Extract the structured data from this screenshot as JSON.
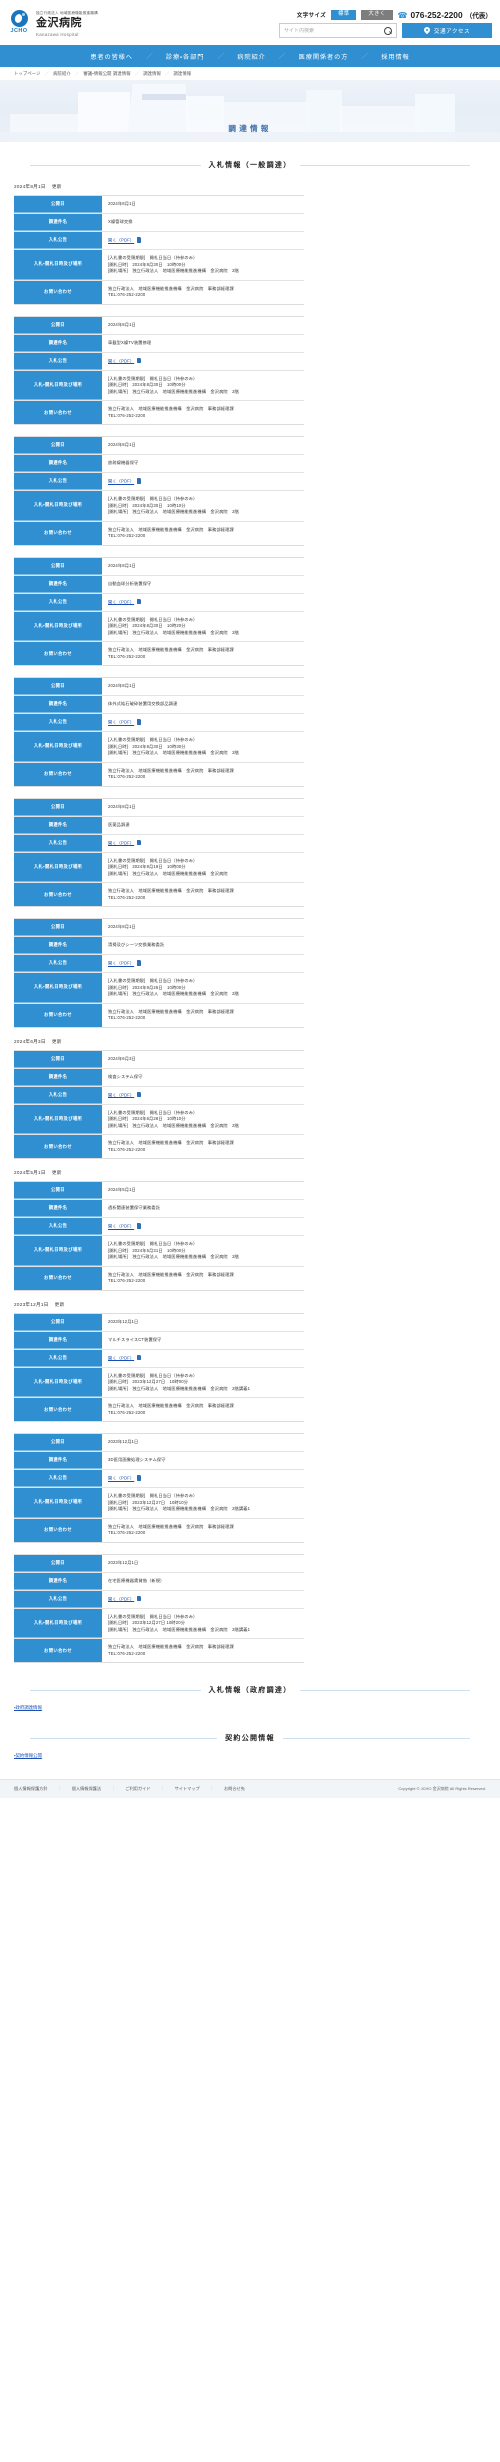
{
  "header": {
    "org_line": "独立行政法人 地域医療機能推進機構",
    "name_jp": "金沢病院",
    "name_en": "Kanazawa Hospital",
    "logo_text": "JCHO",
    "fontsize_label": "文字サイズ",
    "fontsize_standard": "標準",
    "fontsize_large": "大きく",
    "tel_icon": "phone-icon",
    "tel": "076-252-2200",
    "tel_suffix": "（代表）",
    "search_placeholder": "サイト内検索",
    "search_value": "",
    "search_icon": "search-icon",
    "access_label": "交通アクセス",
    "access_icon": "map-pin-icon"
  },
  "nav": {
    "items": [
      "患者の皆様へ",
      "診療・各部門",
      "病院紹介",
      "医療関係者の方",
      "採用情報"
    ],
    "separator": "／"
  },
  "breadcrumb": {
    "items": [
      "トップページ",
      "病院紹介",
      "審議・情報公開 調達情報",
      "調達情報",
      "調達情報"
    ],
    "separator": "／"
  },
  "hero": {
    "title": "調達情報"
  },
  "sections": {
    "ippan_title": "入札情報（一般調達）",
    "seifu_title": "入札情報（政府調達）",
    "keiyaku_title": "契約公開情報",
    "seifu_link": "・政府調達情報",
    "keiyaku_link": "・契約情報公開"
  },
  "labels": {
    "koukaibi": "公開日",
    "choutatsu": "調達件名",
    "koukoku": "入札公告",
    "nyuusatsu": "入札・開札日時及び場所",
    "toiawase": "お問い合わせ",
    "pdf_link": "開く（PDF）",
    "pdf_icon": "pdf-file-icon",
    "update_suffix": "更新",
    "contact_org": "独立行政法人　地域医療機能推進機構　金沢病院　事務部経理課",
    "contact_tel": "TEL:076-252-2200",
    "bid_deadline_label": "[入札書の受領期限]",
    "bid_deadline_value": "開札日当日（持参のみ）",
    "bid_datetime_label": "[開札日時]",
    "bid_place_label": "[開札場所]",
    "bid_place_value": "独立行政法人　地域医療機能推進機構　金沢病院　2階"
  },
  "groups": [
    {
      "date_head": "2024年8月1日",
      "cards": [
        {
          "koukaibi": "2024年8月1日",
          "choutatsu": "X線管球交換",
          "bid_datetime": "2024年8月30日　10時00分",
          "bid_place": "独立行政法人　地域医療機能推進機構　金沢病院　2階"
        },
        {
          "koukaibi": "2024年8月1日",
          "choutatsu": "車載型X線TV装置修理",
          "bid_datetime": "2024年8月30日　10時00分",
          "bid_place": "独立行政法人　地域医療機能推進機構　金沢病院　2階"
        },
        {
          "koukaibi": "2024年8月1日",
          "choutatsu": "放射線機器保守",
          "bid_datetime": "2024年8月30日　10時10分",
          "bid_place": "独立行政法人　地域医療機能推進機構　金沢病院　2階"
        },
        {
          "koukaibi": "2024年8月1日",
          "choutatsu": "自動血球分析装置保守",
          "bid_datetime": "2024年8月30日　10時20分",
          "bid_place": "独立行政法人　地域医療機能推進機構　金沢病院　2階"
        },
        {
          "koukaibi": "2024年8月1日",
          "choutatsu": "体外式結石破砕装置用交換部品調達",
          "bid_datetime": "2024年8月30日　10時30分",
          "bid_place": "独立行政法人　地域医療機能推進機構　金沢病院　2階"
        },
        {
          "koukaibi": "2024年8月1日",
          "choutatsu": "医薬品調達",
          "bid_datetime": "2024年9月19日　10時00分",
          "bid_place": "独立行政法人　地域医療機能推進機構　金沢病院"
        },
        {
          "koukaibi": "2024年8月1日",
          "choutatsu": "清掃及びシーツ交換業務委託",
          "bid_datetime": "2024年9月26日　10時00分",
          "bid_place": "独立行政法人　地域医療機能推進機構　金沢病院　2階"
        }
      ]
    },
    {
      "date_head": "2024年6月3日",
      "cards": [
        {
          "koukaibi": "2024年6月3日",
          "choutatsu": "検査システム保守",
          "bid_datetime": "2024年6月28日　10時10分",
          "bid_place": "独立行政法人　地域医療機能推進機構　金沢病院　2階"
        }
      ]
    },
    {
      "date_head": "2024年5月1日",
      "cards": [
        {
          "koukaibi": "2024年5月1日",
          "choutatsu": "透析関連装置保守業務委託",
          "bid_datetime": "2024年5月31日　10時00分",
          "bid_place": "独立行政法人　地域医療機能推進機構　金沢病院　2階"
        }
      ]
    },
    {
      "date_head": "2023年12月1日",
      "cards": [
        {
          "koukaibi": "2023年12月1日",
          "choutatsu": "マルチスライスCT装置保守",
          "bid_datetime": "2023年12月27日　10時00分",
          "bid_place": "独立行政法人　地域医療機能推進機構　金沢病院　2階講義1"
        },
        {
          "koukaibi": "2023年12月1日",
          "choutatsu": "3D医用画像処理システム保守",
          "bid_datetime": "2023年12月27日　10時10分",
          "bid_place": "独立行政法人　地域医療機能推進機構　金沢病院　2階講義1"
        },
        {
          "koukaibi": "2023年12月1日",
          "choutatsu": "在宅医療機器賃貸借（新規）",
          "bid_datetime": "2023年12月27日 10時20分",
          "bid_place": "独立行政法人　地域医療機能推進機構　金沢病院　2階講義1"
        }
      ]
    }
  ],
  "footer": {
    "links": [
      "個人情報保護方針",
      "個人情報保護法",
      "ご利用ガイド",
      "サイトマップ",
      "お問合せ先"
    ],
    "separator": "｜",
    "copyright": "Copyright © JCHO 金沢病院 All Rights Reserved."
  }
}
